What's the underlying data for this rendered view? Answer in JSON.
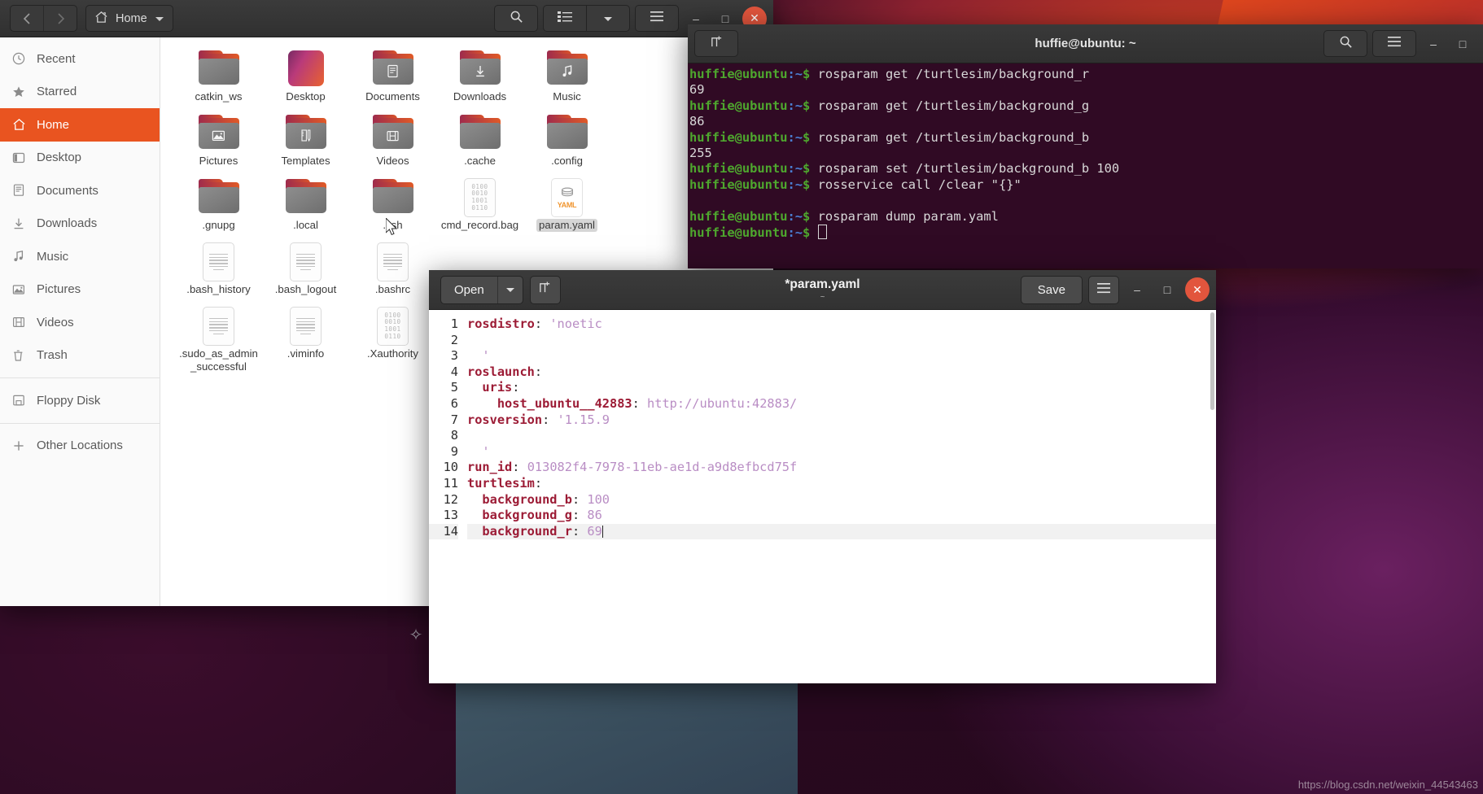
{
  "desktop": {
    "watermark": "https://blog.csdn.net/weixin_44543463"
  },
  "files_window": {
    "title": "Home",
    "nav": {
      "back": "‹",
      "forward": "›"
    },
    "path_label": "Home",
    "toolbar": {
      "search": "search-icon",
      "view_list": "list-view-icon",
      "view_dropdown": "chevron-down-icon",
      "menu": "hamburger-menu-icon",
      "minimize": "–",
      "maximize": "□",
      "close": "✕"
    },
    "sidebar": [
      {
        "label": "Recent",
        "icon": "clock-icon",
        "active": false
      },
      {
        "label": "Starred",
        "icon": "star-icon",
        "active": false
      },
      {
        "label": "Home",
        "icon": "home-icon",
        "active": true
      },
      {
        "label": "Desktop",
        "icon": "desktop-icon",
        "active": false
      },
      {
        "label": "Documents",
        "icon": "document-icon",
        "active": false
      },
      {
        "label": "Downloads",
        "icon": "download-icon",
        "active": false
      },
      {
        "label": "Music",
        "icon": "music-icon",
        "active": false
      },
      {
        "label": "Pictures",
        "icon": "picture-icon",
        "active": false
      },
      {
        "label": "Videos",
        "icon": "video-icon",
        "active": false
      },
      {
        "label": "Trash",
        "icon": "trash-icon",
        "active": false
      },
      {
        "label": "Floppy Disk",
        "icon": "floppy-icon",
        "active": false
      },
      {
        "label": "Other Locations",
        "icon": "plus-icon",
        "active": false
      }
    ],
    "items": [
      {
        "label": "catkin_ws",
        "type": "folder",
        "glyph": "",
        "selected": false
      },
      {
        "label": "Desktop",
        "type": "desktop",
        "glyph": "",
        "selected": false
      },
      {
        "label": "Documents",
        "type": "folder",
        "glyph": "document",
        "selected": false
      },
      {
        "label": "Downloads",
        "type": "folder",
        "glyph": "download",
        "selected": false
      },
      {
        "label": "Music",
        "type": "folder",
        "glyph": "music",
        "selected": false
      },
      {
        "label": "Pictures",
        "type": "folder",
        "glyph": "picture",
        "selected": false
      },
      {
        "label": "Templates",
        "type": "folder",
        "glyph": "template",
        "selected": false
      },
      {
        "label": "Videos",
        "type": "folder",
        "glyph": "video",
        "selected": false
      },
      {
        "label": ".cache",
        "type": "folder",
        "glyph": "",
        "selected": false
      },
      {
        "label": ".config",
        "type": "folder",
        "glyph": "",
        "selected": false
      },
      {
        "label": ".gnupg",
        "type": "folder",
        "glyph": "",
        "selected": false
      },
      {
        "label": ".local",
        "type": "folder",
        "glyph": "",
        "selected": false
      },
      {
        "label": ".ssh",
        "type": "folder",
        "glyph": "",
        "selected": false
      },
      {
        "label": "cmd_record.bag",
        "type": "binary",
        "glyph": "",
        "selected": false
      },
      {
        "label": "param.yaml",
        "type": "yaml",
        "glyph": "YAML",
        "selected": true
      },
      {
        "label": ".bash_history",
        "type": "text",
        "glyph": "",
        "selected": false
      },
      {
        "label": ".bash_logout",
        "type": "text",
        "glyph": "",
        "selected": false
      },
      {
        "label": ".bashrc",
        "type": "text",
        "glyph": "",
        "selected": false
      },
      {
        "label": ".sudo_as_admin_successful",
        "type": "text",
        "glyph": "",
        "selected": false
      },
      {
        "label": ".viminfo",
        "type": "text",
        "glyph": "",
        "selected": false
      },
      {
        "label": ".Xauthority",
        "type": "binary",
        "glyph": "",
        "selected": false
      }
    ]
  },
  "terminal": {
    "title": "huffie@ubuntu: ~",
    "new_tab_icon": "new-tab-icon",
    "search_icon": "search-icon",
    "menu_icon": "hamburger-menu-icon",
    "minimize": "–",
    "maximize": "□",
    "prompt_user": "huffie@ubuntu",
    "prompt_path": ":~",
    "prompt_dollar": "$",
    "lines": [
      {
        "type": "cmd",
        "text": "rosparam get /turtlesim/background_r"
      },
      {
        "type": "out",
        "text": "69"
      },
      {
        "type": "cmd",
        "text": "rosparam get /turtlesim/background_g"
      },
      {
        "type": "out",
        "text": "86"
      },
      {
        "type": "cmd",
        "text": "rosparam get /turtlesim/background_b"
      },
      {
        "type": "out",
        "text": "255"
      },
      {
        "type": "cmd",
        "text": "rosparam set /turtlesim/background_b 100"
      },
      {
        "type": "cmd",
        "text": "rosservice call /clear \"{}\""
      },
      {
        "type": "out",
        "text": ""
      },
      {
        "type": "cmd",
        "text": "rosparam dump param.yaml"
      },
      {
        "type": "cursor",
        "text": ""
      }
    ]
  },
  "gedit": {
    "open_label": "Open",
    "open_arrow": "chevron-down-icon",
    "new_tab_icon": "new-tab-icon",
    "title": "*param.yaml",
    "subtitle": "~",
    "save_label": "Save",
    "menu_icon": "hamburger-menu-icon",
    "minimize": "–",
    "maximize": "□",
    "close": "✕",
    "lines": [
      {
        "n": "1",
        "key": "rosdistro",
        "sep": ": ",
        "val": "'noetic",
        "indent": 0,
        "hl": false
      },
      {
        "n": "2",
        "key": "",
        "sep": "",
        "val": "",
        "indent": 0,
        "hl": false
      },
      {
        "n": "3",
        "key": "",
        "sep": "",
        "val": "'",
        "indent": 1,
        "hl": false
      },
      {
        "n": "4",
        "key": "roslaunch",
        "sep": ":",
        "val": "",
        "indent": 0,
        "hl": false
      },
      {
        "n": "5",
        "key": "uris",
        "sep": ":",
        "val": "",
        "indent": 1,
        "hl": false
      },
      {
        "n": "6",
        "key": "host_ubuntu__42883",
        "sep": ": ",
        "val": "http://ubuntu:42883/",
        "indent": 2,
        "hl": false
      },
      {
        "n": "7",
        "key": "rosversion",
        "sep": ": ",
        "val": "'1.15.9",
        "indent": 0,
        "hl": false
      },
      {
        "n": "8",
        "key": "",
        "sep": "",
        "val": "",
        "indent": 0,
        "hl": false
      },
      {
        "n": "9",
        "key": "",
        "sep": "",
        "val": "'",
        "indent": 1,
        "hl": false
      },
      {
        "n": "10",
        "key": "run_id",
        "sep": ": ",
        "val": "013082f4-7978-11eb-ae1d-a9d8efbcd75f",
        "indent": 0,
        "hl": false
      },
      {
        "n": "11",
        "key": "turtlesim",
        "sep": ":",
        "val": "",
        "indent": 0,
        "hl": false
      },
      {
        "n": "12",
        "key": "background_b",
        "sep": ": ",
        "val": "100",
        "indent": 1,
        "hl": false
      },
      {
        "n": "13",
        "key": "background_g",
        "sep": ": ",
        "val": "86",
        "indent": 1,
        "hl": false
      },
      {
        "n": "14",
        "key": "background_r",
        "sep": ": ",
        "val": "69",
        "indent": 1,
        "hl": true
      }
    ]
  },
  "colors": {
    "accent_orange": "#e95420",
    "terminal_bg": "#300a24",
    "terminal_green": "#4ea72e",
    "terminal_blue": "#4b7fd4",
    "code_key": "#9c1b35",
    "code_value": "#b98dc4",
    "close_red": "#e2553d"
  }
}
